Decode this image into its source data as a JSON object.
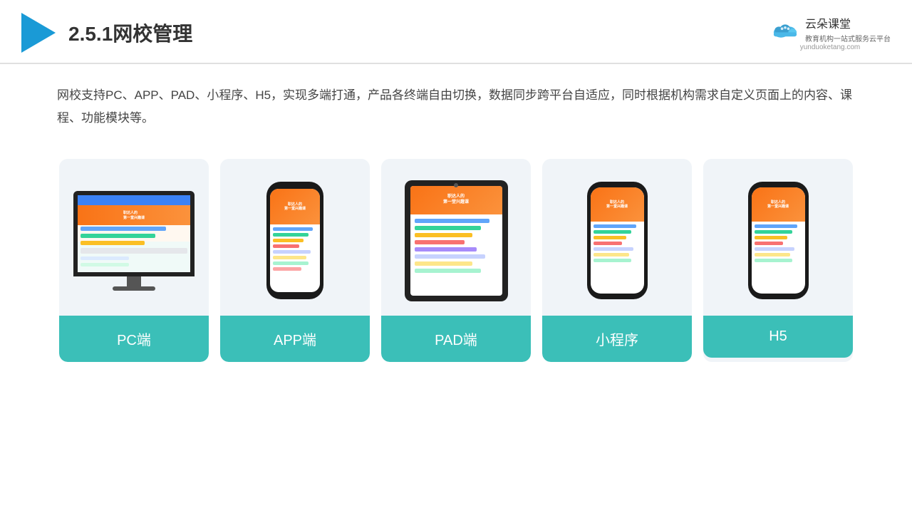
{
  "header": {
    "title": "2.5.1网校管理",
    "brand": {
      "name": "云朵课堂",
      "tagline": "教育机构一站式服务云平台",
      "url": "yunduoketang.com"
    }
  },
  "description": "网校支持PC、APP、PAD、小程序、H5，实现多端打通，产品各终端自由切换，数据同步跨平台自适应，同时根据机构需求自定义页面上的内容、课程、功能模块等。",
  "cards": [
    {
      "id": "pc",
      "label": "PC端"
    },
    {
      "id": "app",
      "label": "APP端"
    },
    {
      "id": "pad",
      "label": "PAD端"
    },
    {
      "id": "miniapp",
      "label": "小程序"
    },
    {
      "id": "h5",
      "label": "H5"
    }
  ],
  "colors": {
    "accent": "#3bbfb8",
    "header_border": "#e0e0e0",
    "title_color": "#333333",
    "description_color": "#444444",
    "card_bg": "#f0f4f8"
  }
}
